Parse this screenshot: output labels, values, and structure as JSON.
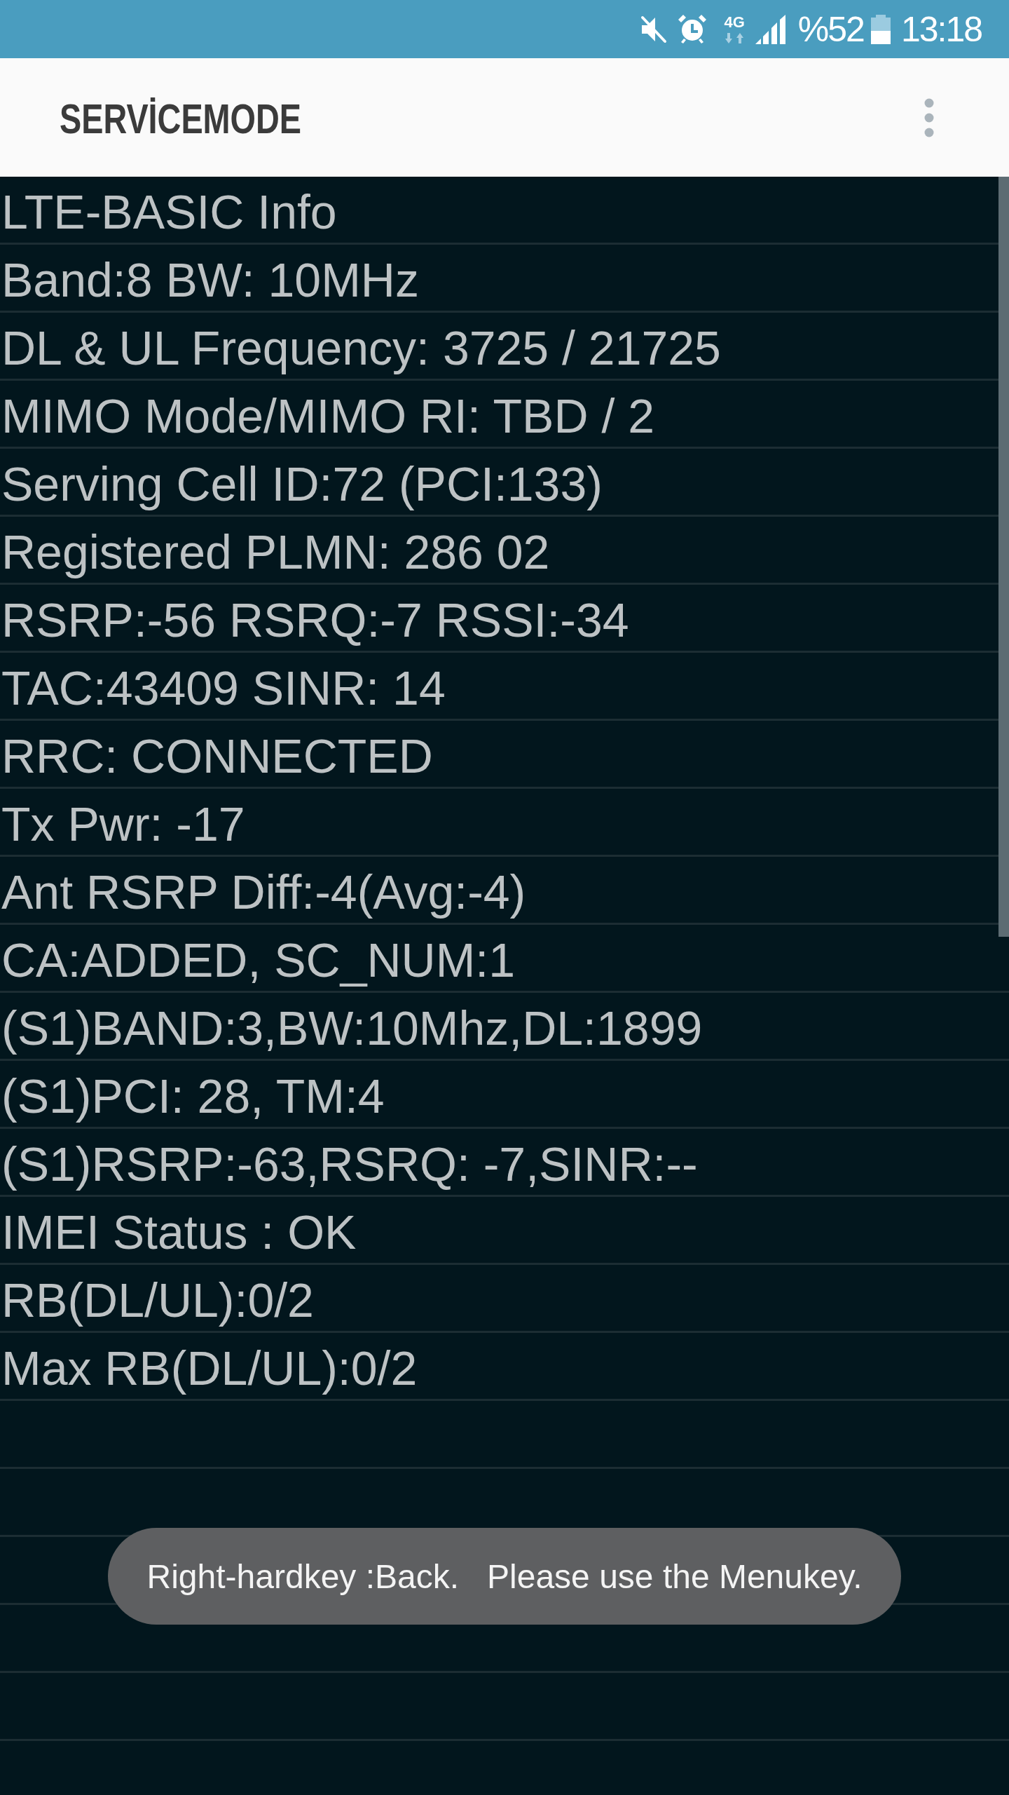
{
  "status_bar": {
    "network_type": "4G",
    "battery": "%52",
    "time": "13:18"
  },
  "app_bar": {
    "title": "SERVİCEMODE"
  },
  "info_lines": [
    "LTE-BASIC Info",
    "Band:8 BW: 10MHz",
    "DL & UL Frequency: 3725 / 21725",
    "MIMO Mode/MIMO RI: TBD / 2",
    "Serving Cell ID:72 (PCI:133)",
    "Registered PLMN: 286 02",
    "RSRP:-56 RSRQ:-7 RSSI:-34",
    "TAC:43409 SINR: 14",
    "RRC: CONNECTED",
    "Tx Pwr: -17",
    "Ant RSRP Diff:-4(Avg:-4)",
    "CA:ADDED, SC_NUM:1",
    "(S1)BAND:3,BW:10Mhz,DL:1899",
    "(S1)PCI: 28, TM:4",
    "(S1)RSRP:-63,RSRQ: -7,SINR:--",
    "IMEI Status : OK",
    "RB(DL/UL):0/2",
    "Max RB(DL/UL):0/2"
  ],
  "toast": {
    "message": "Right-hardkey :Back.   Please use the Menukey."
  }
}
